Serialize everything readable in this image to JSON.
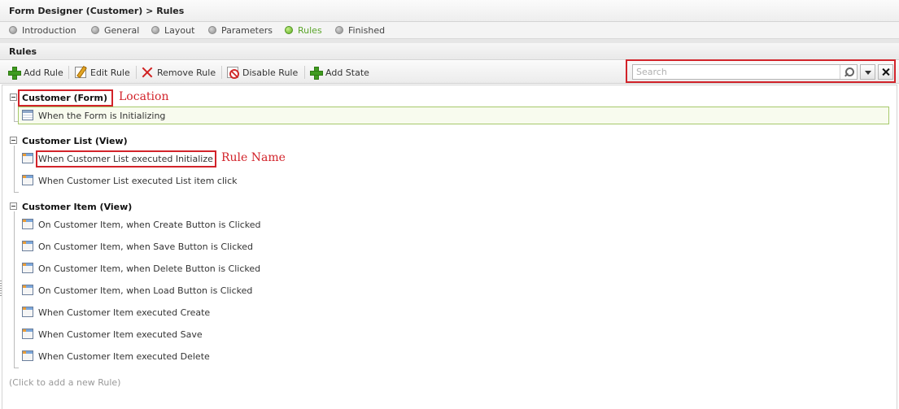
{
  "header": {
    "title": "Form Designer (Customer) > Rules"
  },
  "steps": [
    {
      "label": "Introduction",
      "active": false
    },
    {
      "label": "General",
      "active": false
    },
    {
      "label": "Layout",
      "active": false
    },
    {
      "label": "Parameters",
      "active": false
    },
    {
      "label": "Rules",
      "active": true
    },
    {
      "label": "Finished",
      "active": false
    }
  ],
  "section": {
    "title": "Rules"
  },
  "toolbar": {
    "add_rule": "Add Rule",
    "edit_rule": "Edit Rule",
    "remove_rule": "Remove Rule",
    "disable_rule": "Disable Rule",
    "add_state": "Add State"
  },
  "search": {
    "placeholder": "Search",
    "value": ""
  },
  "tree": {
    "groups": [
      {
        "label": "Customer (Form)",
        "rules": [
          {
            "label": "When the Form is Initializing",
            "icon": "form-rule-icon",
            "selected": true
          }
        ]
      },
      {
        "label": "Customer List (View)",
        "rules": [
          {
            "label": "When Customer List executed Initialize",
            "icon": "view-rule-icon"
          },
          {
            "label": "When Customer List executed List item click",
            "icon": "view-rule-icon"
          }
        ]
      },
      {
        "label": "Customer Item (View)",
        "rules": [
          {
            "label": "On Customer Item, when Create Button is Clicked",
            "icon": "view-rule-icon"
          },
          {
            "label": "On Customer Item, when Save Button is Clicked",
            "icon": "view-rule-icon"
          },
          {
            "label": "On Customer Item, when Delete Button is Clicked",
            "icon": "view-rule-icon"
          },
          {
            "label": "On Customer Item, when Load Button is Clicked",
            "icon": "view-rule-icon"
          },
          {
            "label": "When Customer Item executed Create",
            "icon": "view-rule-icon"
          },
          {
            "label": "When Customer Item executed Save",
            "icon": "view-rule-icon"
          },
          {
            "label": "When Customer Item executed Delete",
            "icon": "view-rule-icon"
          }
        ]
      }
    ],
    "add_hint": "(Click to add a new Rule)"
  },
  "annotations": {
    "location": "Location",
    "rule_name": "Rule Name"
  },
  "colors": {
    "annotation": "#d2232a",
    "active_step": "#5aa52a",
    "selected_border": "#a7c96b"
  }
}
